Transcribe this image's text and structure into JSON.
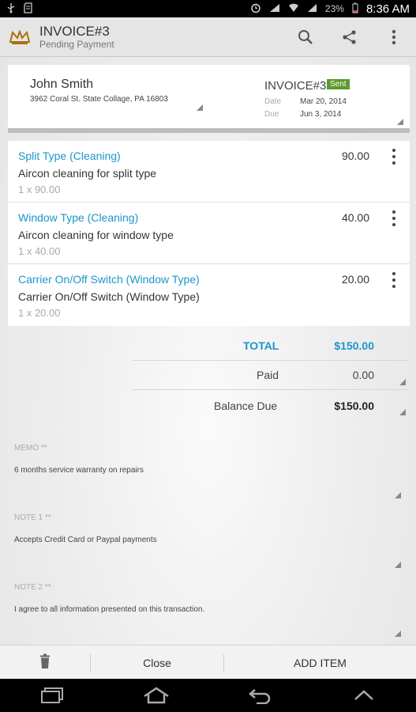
{
  "status_bar": {
    "battery_percent": "23%",
    "time": "8:36 AM"
  },
  "action_bar": {
    "title": "INVOICE#3",
    "subtitle": "Pending Payment",
    "icons": [
      "crown-logo-icon",
      "search-icon",
      "share-icon",
      "overflow-menu-icon"
    ]
  },
  "invoice_header": {
    "customer_name": "John Smith",
    "customer_address": "3962 Coral St. State Collage, PA 16803",
    "invoice_number": "INVOICE#3",
    "status_badge": "Sent",
    "date_label": "Date",
    "date_value": "Mar 20, 2014",
    "due_label": "Due",
    "due_value": "Jun 3, 2014"
  },
  "items": [
    {
      "title": "Split Type (Cleaning)",
      "description": "Aircon cleaning for split type",
      "qty": "1 x 90.00",
      "amount": "90.00"
    },
    {
      "title": "Window Type (Cleaning)",
      "description": "Aircon cleaning for window type",
      "qty": "1 x 40.00",
      "amount": "40.00"
    },
    {
      "title": "Carrier On/Off Switch (Window Type)",
      "description": "Carrier On/Off Switch (Window Type)",
      "qty": "1 x 20.00",
      "amount": "20.00"
    }
  ],
  "totals": {
    "total_label": "TOTAL",
    "total_value": "$150.00",
    "paid_label": "Paid",
    "paid_value": "0.00",
    "balance_label": "Balance Due",
    "balance_value": "$150.00"
  },
  "notes": {
    "memo_label": "MEMO **",
    "memo_text": "6 months service warranty on repairs",
    "note1_label": "NOTE 1 **",
    "note1_text": "Accepts Credit Card or Paypal payments",
    "note2_label": "NOTE 2 **",
    "note2_text": "I agree to all information presented on this transaction."
  },
  "bottom_bar": {
    "close_label": "Close",
    "add_item_label": "ADD ITEM"
  },
  "colors": {
    "accent": "#1b97c9",
    "sent_badge": "#5a9a2d"
  }
}
